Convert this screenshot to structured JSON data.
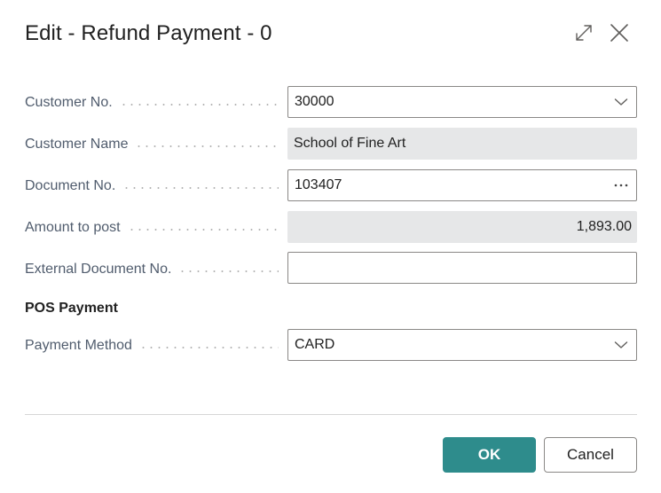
{
  "dialog": {
    "title": "Edit - Refund Payment - 0",
    "expand_icon": "expand-icon",
    "close_icon": "close-icon"
  },
  "fields": {
    "customer_no": {
      "label": "Customer No.",
      "value": "30000",
      "control": "dropdown"
    },
    "customer_name": {
      "label": "Customer Name",
      "value": "School of Fine Art",
      "control": "readonly"
    },
    "document_no": {
      "label": "Document No.",
      "value": "103407",
      "control": "lookup"
    },
    "amount_to_post": {
      "label": "Amount to post",
      "value": "1,893.00",
      "control": "readonly"
    },
    "external_document_no": {
      "label": "External Document No.",
      "value": "",
      "control": "text"
    }
  },
  "pos_payment": {
    "section_title": "POS Payment",
    "payment_method": {
      "label": "Payment Method",
      "value": "CARD",
      "control": "dropdown"
    }
  },
  "footer": {
    "ok_label": "OK",
    "cancel_label": "Cancel"
  },
  "colors": {
    "primary": "#2e8c8c",
    "readonly_bg": "#e6e7e8",
    "label": "#505c6d"
  }
}
